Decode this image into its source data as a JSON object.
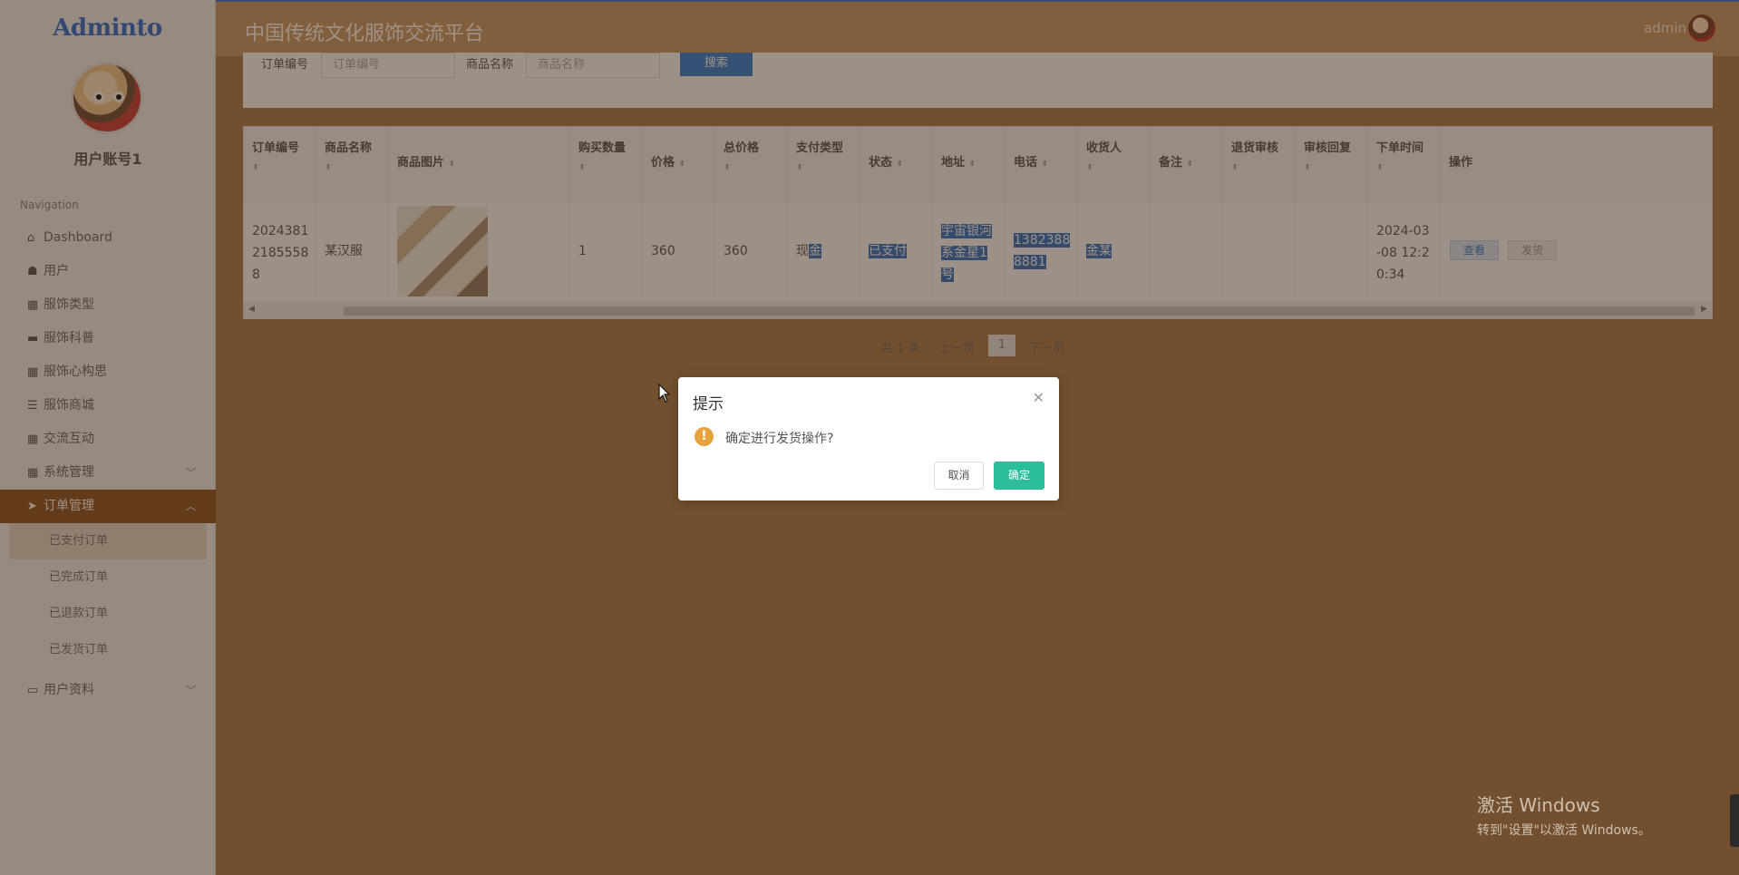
{
  "brand": "Adminto",
  "account_name": "用户账号1",
  "nav_title": "Navigation",
  "nav": [
    {
      "label": "Dashboard",
      "icon": "home-icon"
    },
    {
      "label": "用户",
      "icon": "user-icon"
    },
    {
      "label": "服饰类型",
      "icon": "grid-icon"
    },
    {
      "label": "服饰科普",
      "icon": "book-icon"
    },
    {
      "label": "服饰心构思",
      "icon": "grid-icon"
    },
    {
      "label": "服饰商城",
      "icon": "list-icon"
    },
    {
      "label": "交流互动",
      "icon": "grid-icon"
    },
    {
      "label": "系统管理",
      "icon": "grid-icon"
    },
    {
      "label": "订单管理",
      "icon": "send-icon"
    },
    {
      "label": "用户资料",
      "icon": "card-icon"
    }
  ],
  "order_submenu": [
    "已支付订单",
    "已完成订单",
    "已退款订单",
    "已发货订单"
  ],
  "topbar": {
    "title": "中国传统文化服饰交流平台",
    "user": "admin"
  },
  "search": {
    "order_label": "订单编号",
    "order_placeholder": "订单编号",
    "product_label": "商品名称",
    "product_placeholder": "商品名称",
    "button": "搜索"
  },
  "table": {
    "headers": [
      "订单编号",
      "商品名称",
      "商品图片",
      "购买数量",
      "价格",
      "总价格",
      "支付类型",
      "状态",
      "地址",
      "电话",
      "收货人",
      "备注",
      "退货审核",
      "审核回复",
      "下单时间",
      "操作"
    ],
    "row": {
      "order_no": "20243812185558 8",
      "order_no_lines": [
        "2024381",
        "2185558",
        "8"
      ],
      "product": "某汉服",
      "quantity": "1",
      "price": "360",
      "total": "360",
      "pay_type_a": "现",
      "pay_type_b": "金",
      "status": "已支付",
      "address_lines": [
        "宇宙银河",
        "系金星1",
        "号"
      ],
      "phone_lines": [
        "1382388",
        "8881"
      ],
      "receiver": "金某",
      "remark": "",
      "return_audit": "",
      "audit_reply": "",
      "time_lines": [
        "2024-03",
        "-08 12:2",
        "0:34"
      ],
      "actions": [
        "查看",
        "发货"
      ]
    }
  },
  "pagination": {
    "total": "共 1 条",
    "prev": "上一页",
    "page": "1",
    "next": "下一页"
  },
  "modal": {
    "title": "提示",
    "message": "确定进行发货操作?",
    "cancel": "取消",
    "confirm": "确定"
  },
  "watermark": {
    "line1": "激活 Windows",
    "line2": "转到\"设置\"以激活 Windows。"
  }
}
